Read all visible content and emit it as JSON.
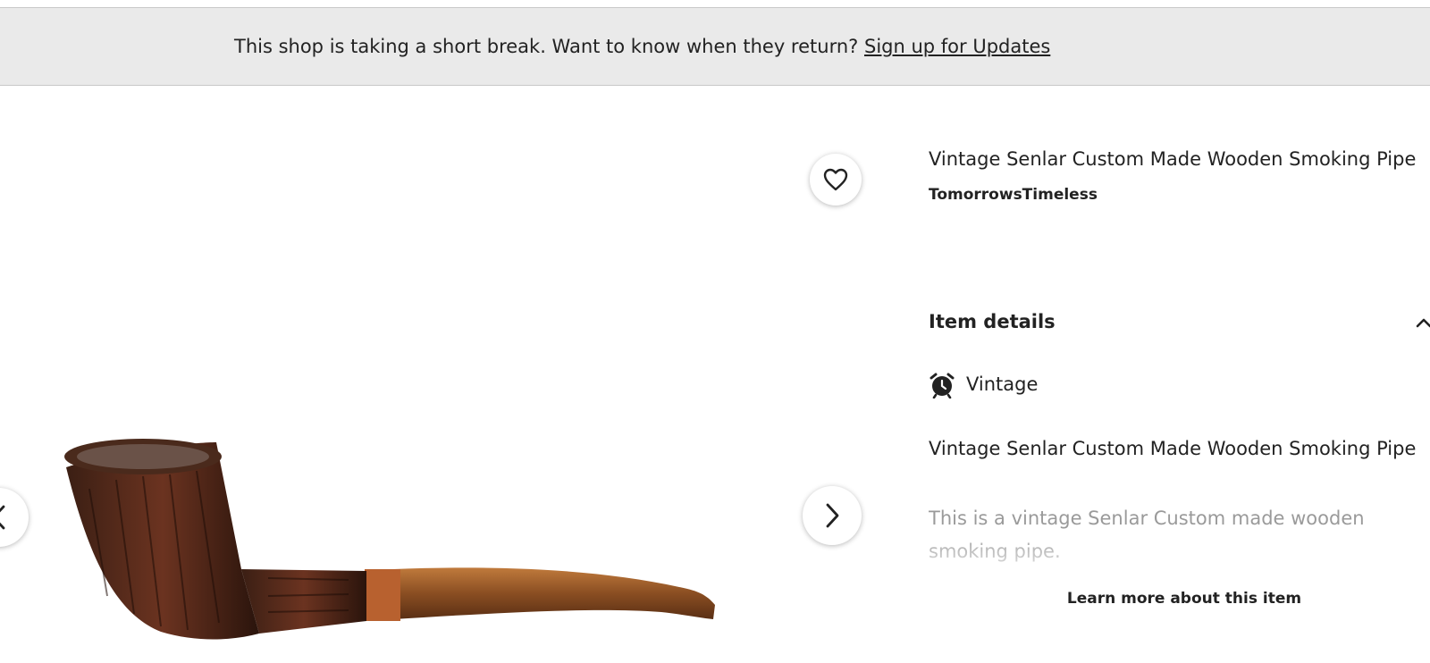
{
  "banner": {
    "message": "This shop is taking a short break. Want to know when they return?",
    "link_label": "Sign up for Updates"
  },
  "gallery": {
    "image_alt": "Vintage Senlar Custom Made Wooden Smoking Pipe",
    "favorite_icon": "heart-icon",
    "next_icon": "chevron-right-icon",
    "prev_icon": "chevron-left-icon"
  },
  "listing": {
    "title": "Vintage Senlar Custom Made Wooden Smoking Pipe",
    "shop_name": "TomorrowsTimeless"
  },
  "item_details": {
    "heading": "Item details",
    "toggle_icon": "chevron-up-icon",
    "vintage_icon": "alarm-clock-icon",
    "vintage_label": "Vintage",
    "description_title": "Vintage Senlar Custom Made Wooden Smoking Pipe",
    "description_text": "This is a vintage Senlar Custom made wooden smoking pipe.",
    "learn_more_label": "Learn more about this item"
  },
  "colors": {
    "banner_bg": "#eaeaea",
    "text": "#222222",
    "muted_text": "#9a9a9a"
  }
}
